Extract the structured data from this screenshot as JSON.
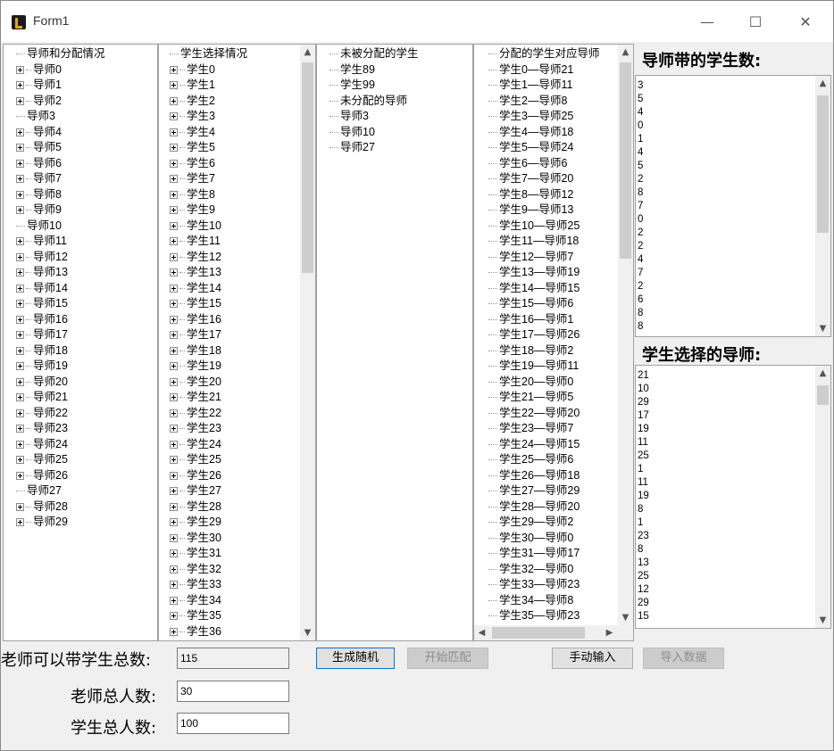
{
  "window": {
    "title": "Form1",
    "minimize_glyph": "—",
    "maximize_glyph": "☐",
    "close_glyph": "✕"
  },
  "tutor_tree": {
    "root_label": "导师和分配情况",
    "nodes": [
      {
        "label": "导师0",
        "expandable": true
      },
      {
        "label": "导师1",
        "expandable": true
      },
      {
        "label": "导师2",
        "expandable": true
      },
      {
        "label": "导师3",
        "expandable": false
      },
      {
        "label": "导师4",
        "expandable": true
      },
      {
        "label": "导师5",
        "expandable": true
      },
      {
        "label": "导师6",
        "expandable": true
      },
      {
        "label": "导师7",
        "expandable": true
      },
      {
        "label": "导师8",
        "expandable": true
      },
      {
        "label": "导师9",
        "expandable": true
      },
      {
        "label": "导师10",
        "expandable": false
      },
      {
        "label": "导师11",
        "expandable": true
      },
      {
        "label": "导师12",
        "expandable": true
      },
      {
        "label": "导师13",
        "expandable": true
      },
      {
        "label": "导师14",
        "expandable": true
      },
      {
        "label": "导师15",
        "expandable": true
      },
      {
        "label": "导师16",
        "expandable": true
      },
      {
        "label": "导师17",
        "expandable": true
      },
      {
        "label": "导师18",
        "expandable": true
      },
      {
        "label": "导师19",
        "expandable": true
      },
      {
        "label": "导师20",
        "expandable": true
      },
      {
        "label": "导师21",
        "expandable": true
      },
      {
        "label": "导师22",
        "expandable": true
      },
      {
        "label": "导师23",
        "expandable": true
      },
      {
        "label": "导师24",
        "expandable": true
      },
      {
        "label": "导师25",
        "expandable": true
      },
      {
        "label": "导师26",
        "expandable": true
      },
      {
        "label": "导师27",
        "expandable": false
      },
      {
        "label": "导师28",
        "expandable": true
      },
      {
        "label": "导师29",
        "expandable": true
      }
    ]
  },
  "student_tree": {
    "root_label": "学生选择情况",
    "nodes": [
      "学生0",
      "学生1",
      "学生2",
      "学生3",
      "学生4",
      "学生5",
      "学生6",
      "学生7",
      "学生8",
      "学生9",
      "学生10",
      "学生11",
      "学生12",
      "学生13",
      "学生14",
      "学生15",
      "学生16",
      "学生17",
      "学生18",
      "学生19",
      "学生20",
      "学生21",
      "学生22",
      "学生23",
      "学生24",
      "学生25",
      "学生26",
      "学生27",
      "学生28",
      "学生29",
      "学生30",
      "学生31",
      "学生32",
      "学生33",
      "学生34",
      "学生35",
      "学生36"
    ]
  },
  "unassigned_tree": {
    "lines": [
      "未被分配的学生",
      "学生89",
      "学生99",
      "未分配的导师",
      "导师3",
      "导师10",
      "导师27"
    ]
  },
  "assignment_tree": {
    "root_label": "分配的学生对应导师",
    "lines": [
      "学生0—导师21",
      "学生1—导师11",
      "学生2—导师8",
      "学生3—导师25",
      "学生4—导师18",
      "学生5—导师24",
      "学生6—导师6",
      "学生7—导师20",
      "学生8—导师12",
      "学生9—导师13",
      "学生10—导师25",
      "学生11—导师18",
      "学生12—导师7",
      "学生13—导师19",
      "学生14—导师15",
      "学生15—导师6",
      "学生16—导师1",
      "学生17—导师26",
      "学生18—导师2",
      "学生19—导师11",
      "学生20—导师0",
      "学生21—导师5",
      "学生22—导师20",
      "学生23—导师7",
      "学生24—导师15",
      "学生25—导师6",
      "学生26—导师18",
      "学生27—导师29",
      "学生28—导师20",
      "学生29—导师2",
      "学生30—导师0",
      "学生31—导师17",
      "学生32—导师0",
      "学生33—导师23",
      "学生34—导师8",
      "学生35—导师23"
    ]
  },
  "tutor_counts": {
    "heading": "导师带的学生数:",
    "values": [
      "3",
      "5",
      "4",
      "0",
      "1",
      "4",
      "5",
      "2",
      "8",
      "7",
      "0",
      "2",
      "2",
      "4",
      "7",
      "2",
      "6",
      "8",
      "8"
    ]
  },
  "student_choices": {
    "heading": "学生选择的导师:",
    "values": [
      "21",
      "10",
      "29",
      "17",
      "19",
      "11",
      "25",
      "1",
      "11",
      "19",
      "8",
      "1",
      "23",
      "8",
      "13",
      "25",
      "12",
      "29",
      "15"
    ]
  },
  "form": {
    "capacity_label": "老师可以带学生总数:",
    "capacity_value": "115",
    "teacher_count_label": "老师总人数:",
    "teacher_count_value": "30",
    "student_count_label": "学生总人数:",
    "student_count_value": "100"
  },
  "buttons": {
    "generate_random": "生成随机",
    "start_match": "开始匹配",
    "manual_input": "手动输入",
    "import_data": "导入数据"
  }
}
